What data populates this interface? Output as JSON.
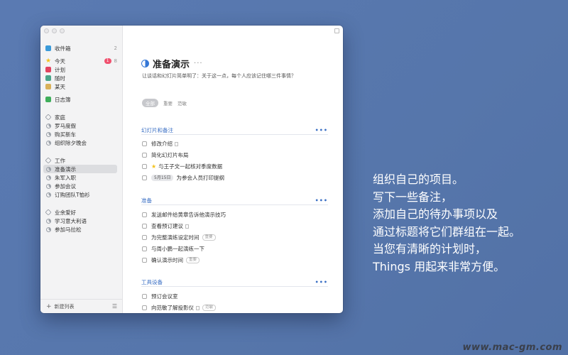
{
  "sidebar": {
    "inbox": {
      "label": "收件箱",
      "count": "2"
    },
    "today": {
      "label": "今天",
      "badge": "1",
      "count": "8"
    },
    "plan": {
      "label": "计划"
    },
    "anytime": {
      "label": "随时"
    },
    "someday": {
      "label": "某天"
    },
    "logbook": {
      "label": "日志簿"
    },
    "areas": [
      {
        "label": "家庭",
        "projects": [
          "罗马度假",
          "购买新车",
          "组织除夕晚会"
        ]
      },
      {
        "label": "工作",
        "projects": [
          "准备演示",
          "朱军入职",
          "参加会议",
          "订购团队T恤衫"
        ]
      },
      {
        "label": "业余爱好",
        "projects": [
          "学习意大利语",
          "参加马拉松"
        ]
      }
    ],
    "footer": {
      "new_list": "新建列表"
    }
  },
  "project": {
    "title": "准备演示",
    "more": "···",
    "notes": "让谈话和幻灯片简单明了：关于这一点，每个人应该记住哪三件事情？",
    "tags": [
      "全部",
      "重要",
      "范敏"
    ]
  },
  "sections": [
    {
      "heading": "幻灯片和备注",
      "todos": [
        {
          "text": "修改介绍",
          "note": true
        },
        {
          "text": "简化幻灯片布局"
        },
        {
          "text": "与王子文一起核对季度数据",
          "star": true
        },
        {
          "text": "为参会人员打印提纲",
          "date": "5月15日"
        }
      ]
    },
    {
      "heading": "准备",
      "todos": [
        {
          "text": "发送邮件给黄章告诉他演示技巧"
        },
        {
          "text": "查看预订建议",
          "note": true
        },
        {
          "text": "为完整演练设定时间",
          "tag": "重要"
        },
        {
          "text": "与周小鹏一起演练一下"
        },
        {
          "text": "确认演示时间",
          "tag": "重要"
        }
      ]
    },
    {
      "heading": "工具设备",
      "todos": [
        {
          "text": "预订会议室"
        },
        {
          "text": "向范敏了解投影仪",
          "note": true,
          "tag": "范敏"
        }
      ]
    }
  ],
  "promo": [
    "组织自己的项目。",
    "写下一些备注，",
    "添加自己的待办事项以及",
    "通过标题将它们群组在一起。",
    "当您有清晰的计划时，",
    "Things 用起来非常方便。"
  ],
  "watermark": "www.mac-gm.com",
  "colors": {
    "accent": "#3477d6",
    "background": "#5a7ab2",
    "today_badge": "#f0506e",
    "star": "#f3c21b"
  }
}
